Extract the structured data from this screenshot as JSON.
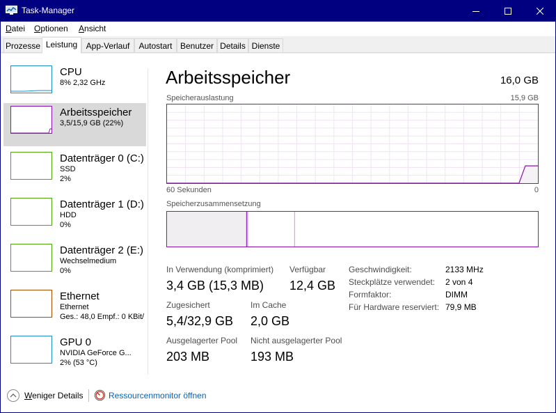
{
  "window": {
    "title": "Task-Manager"
  },
  "menu": {
    "items": [
      {
        "mnemonic": "D",
        "rest": "atei"
      },
      {
        "mnemonic": "O",
        "rest": "ptionen"
      },
      {
        "mnemonic": "A",
        "rest": "nsicht"
      }
    ]
  },
  "tabs": [
    "Prozesse",
    "Leistung",
    "App-Verlauf",
    "Autostart",
    "Benutzer",
    "Details",
    "Dienste"
  ],
  "active_tab": "Leistung",
  "resources": [
    {
      "name": "CPU",
      "sub": "8%  2,32 GHz",
      "sub2": "",
      "color": "#1b8dc4"
    },
    {
      "name": "Arbeitsspeicher",
      "sub": "3,5/15,9 GB (22%)",
      "sub2": "",
      "color": "#8b12ae"
    },
    {
      "name": "Datenträger 0 (C:)",
      "sub": "SSD",
      "sub2": "2%",
      "color": "#4da60c"
    },
    {
      "name": "Datenträger 1 (D:)",
      "sub": "HDD",
      "sub2": "0%",
      "color": "#4da60c"
    },
    {
      "name": "Datenträger 2 (E:)",
      "sub": "Wechselmedium",
      "sub2": "0%",
      "color": "#4da60c"
    },
    {
      "name": "Ethernet",
      "sub": "Ethernet",
      "sub2": "Ges.: 48,0  Empf.: 0 KBit/",
      "color": "#a74f01"
    },
    {
      "name": "GPU 0",
      "sub": "NVIDIA GeForce G...",
      "sub2": "2% (53 °C)",
      "color": "#1b8dc4"
    }
  ],
  "main": {
    "title": "Arbeitsspeicher",
    "total": "16,0 GB",
    "usage_label": "Speicherauslastung",
    "usage_max": "15,9 GB",
    "time_left": "60 Sekunden",
    "time_right": "0",
    "composition_label": "Speicherzusammensetzung",
    "usage_history_fraction": [
      0,
      0,
      0,
      0,
      0,
      0,
      0,
      0,
      0,
      0,
      0,
      0,
      0,
      0,
      0,
      0,
      0,
      0,
      0,
      0,
      0,
      0,
      0,
      0,
      0,
      0,
      0,
      0,
      0,
      0,
      0,
      0,
      0,
      0,
      0,
      0,
      0,
      0,
      0,
      0,
      0,
      0,
      0,
      0,
      0,
      0,
      0,
      0,
      0,
      0,
      0,
      0,
      0,
      0,
      0,
      0,
      0,
      0.22,
      0.22,
      0.22
    ],
    "composition": {
      "in_use_gb": 3.4,
      "modified_gb": 0.05,
      "standby_gb": 2.0,
      "free_gb": 10.4
    },
    "accent": "#8b12ae",
    "stats": {
      "in_use": {
        "label": "In Verwendung (komprimiert)",
        "value": "3,4 GB (15,3 MB)"
      },
      "available": {
        "label": "Verfügbar",
        "value": "12,4 GB"
      },
      "committed": {
        "label": "Zugesichert",
        "value": "5,4/32,9 GB"
      },
      "cached": {
        "label": "Im Cache",
        "value": "2,0 GB"
      },
      "paged": {
        "label": "Ausgelagerter Pool",
        "value": "203 MB"
      },
      "nonpaged": {
        "label": "Nicht ausgelagerter Pool",
        "value": "193 MB"
      }
    },
    "details": [
      {
        "key": "Geschwindigkeit:",
        "value": "2133 MHz"
      },
      {
        "key": "Steckplätze verwendet:",
        "value": "2 von 4"
      },
      {
        "key": "Formfaktor:",
        "value": "DIMM"
      },
      {
        "key": "Für Hardware reserviert:",
        "value": "79,9 MB"
      }
    ]
  },
  "footer": {
    "fewer_mnemonic": "W",
    "fewer_rest": "eniger Details",
    "resmon": "Ressourcenmonitor öffnen"
  }
}
